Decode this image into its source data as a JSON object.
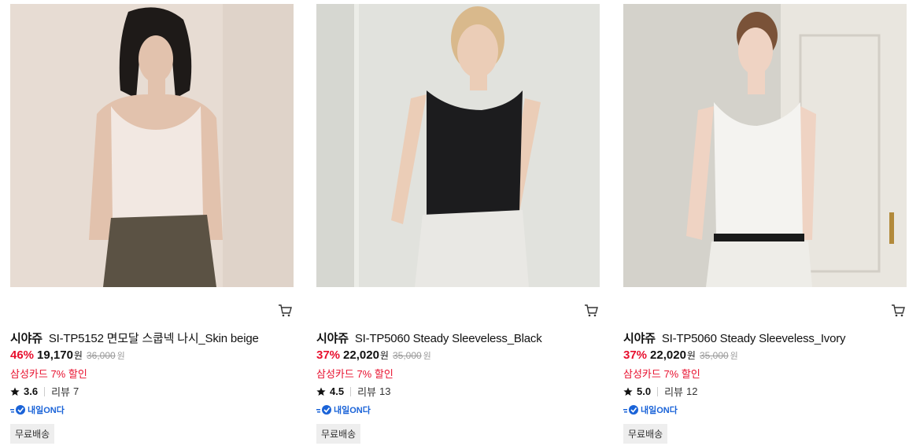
{
  "products": [
    {
      "brand": "시야쥬",
      "title": "SI-TP5152 면모달 스쿱넥 나시_Skin beige",
      "discount": "46%",
      "price": "19,170",
      "price_unit": "원",
      "original_price": "36,000",
      "original_unit": "원",
      "card_promo": "삼성카드 7% 할인",
      "rating": "3.6",
      "review_label": "리뷰",
      "review_count": "7",
      "delivery_badge": "내일ON다",
      "shipping": "무료배송",
      "image_icon": "product-photo-skin-beige"
    },
    {
      "brand": "시야쥬",
      "title": "SI-TP5060 Steady Sleeveless_Black",
      "discount": "37%",
      "price": "22,020",
      "price_unit": "원",
      "original_price": "35,000",
      "original_unit": "원",
      "card_promo": "삼성카드 7% 할인",
      "rating": "4.5",
      "review_label": "리뷰",
      "review_count": "13",
      "delivery_badge": "내일ON다",
      "shipping": "무료배송",
      "image_icon": "product-photo-black"
    },
    {
      "brand": "시야쥬",
      "title": "SI-TP5060 Steady Sleeveless_Ivory",
      "discount": "37%",
      "price": "22,020",
      "price_unit": "원",
      "original_price": "35,000",
      "original_unit": "원",
      "card_promo": "삼성카드 7% 할인",
      "rating": "5.0",
      "review_label": "리뷰",
      "review_count": "12",
      "delivery_badge": "내일ON다",
      "shipping": "무료배송",
      "image_icon": "product-photo-ivory"
    }
  ],
  "colors": {
    "discount": "#e8102e",
    "badge_blue": "#1a63d8"
  }
}
